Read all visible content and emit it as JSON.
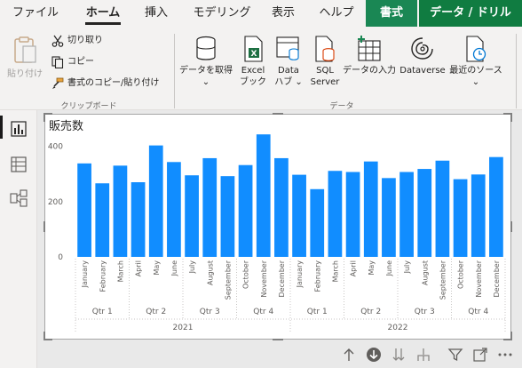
{
  "menu": {
    "tabs": [
      "ファイル",
      "ホーム",
      "挿入",
      "モデリング",
      "表示",
      "ヘルプ",
      "書式",
      "データ / ドリル"
    ]
  },
  "ribbon": {
    "clipboard": {
      "paste": "貼り付け",
      "cut": "切り取り",
      "copy": "コピー",
      "format_painter": "書式のコピー/貼り付け",
      "group_label": "クリップボード"
    },
    "data": {
      "get_data": "データを取得",
      "excel_line1": "Excel",
      "excel_line2": "ブック",
      "datahub_line1": "Data",
      "datahub_line2": "ハブ",
      "sql_line1": "SQL",
      "sql_line2": "Server",
      "enter_data": "データの入力",
      "dataverse": "Dataverse",
      "recent": "最近のソース",
      "group_label": "データ"
    },
    "colors": {
      "excel_green": "#1d6f42",
      "accent_green": "#1a8754",
      "accent_green2": "#107c41"
    }
  },
  "visual": {
    "title": "販売数"
  },
  "chart_data": {
    "type": "bar",
    "title": "販売数",
    "bar_color": "#118dff",
    "ylim": [
      0,
      450
    ],
    "yticks": [
      0,
      200,
      400
    ],
    "categories": [
      "January",
      "February",
      "March",
      "April",
      "May",
      "June",
      "July",
      "August",
      "September",
      "October",
      "November",
      "December",
      "January",
      "February",
      "March",
      "April",
      "May",
      "June",
      "July",
      "August",
      "September",
      "October",
      "November",
      "December"
    ],
    "values": [
      338,
      266,
      330,
      270,
      403,
      343,
      295,
      357,
      292,
      332,
      443,
      357,
      297,
      245,
      311,
      307,
      345,
      285,
      307,
      318,
      348,
      281,
      298,
      361
    ],
    "quarters": [
      {
        "label": "Qtr 1"
      },
      {
        "label": "Qtr 2"
      },
      {
        "label": "Qtr 3"
      },
      {
        "label": "Qtr 4"
      },
      {
        "label": "Qtr 1"
      },
      {
        "label": "Qtr 2"
      },
      {
        "label": "Qtr 3"
      },
      {
        "label": "Qtr 4"
      }
    ],
    "years": [
      {
        "label": "2021"
      },
      {
        "label": "2022"
      }
    ],
    "grid": false
  }
}
